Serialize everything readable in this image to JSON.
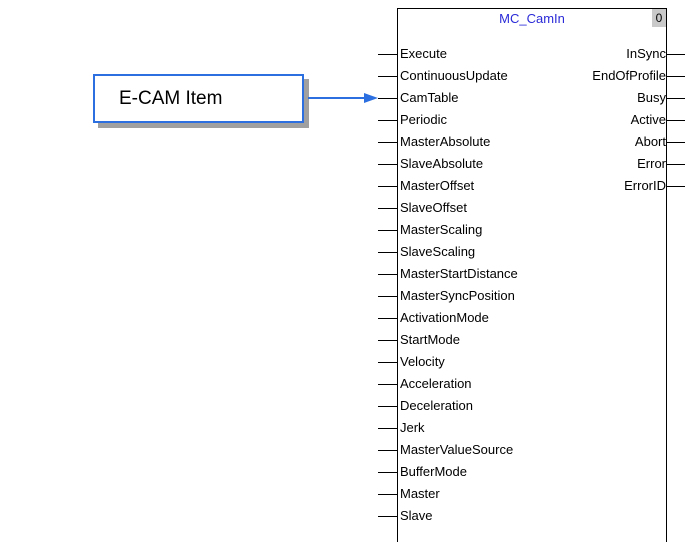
{
  "callout": {
    "text": "E-CAM Item"
  },
  "block": {
    "title": "MC_CamIn",
    "instance": "0",
    "inputs": [
      "Execute",
      "ContinuousUpdate",
      "CamTable",
      "Periodic",
      "MasterAbsolute",
      "SlaveAbsolute",
      "MasterOffset",
      "SlaveOffset",
      "MasterScaling",
      "SlaveScaling",
      "MasterStartDistance",
      "MasterSyncPosition",
      "ActivationMode",
      "StartMode",
      "Velocity",
      "Acceleration",
      "Deceleration",
      "Jerk",
      "MasterValueSource",
      "BufferMode",
      "Master",
      "Slave"
    ],
    "outputs": [
      "InSync",
      "EndOfProfile",
      "Busy",
      "Active",
      "Abort",
      "Error",
      "ErrorID"
    ]
  },
  "colors": {
    "title": "#2a2ad8",
    "callout_border": "#2b6fe0",
    "arrow": "#2b6fe0"
  }
}
